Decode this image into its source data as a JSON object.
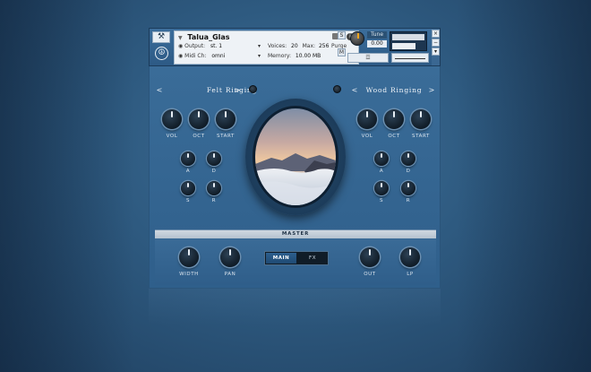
{
  "header": {
    "instrument_name": "Talua_Glas",
    "output_label": "Output:",
    "output_value": "st. 1",
    "midi_label": "Midi Ch:",
    "midi_value": "omni",
    "voices_label": "Voices:",
    "voices_value": "20",
    "max_label": "Max:",
    "max_value": "256",
    "purge_label": "Purge",
    "memory_label": "Memory:",
    "memory_value": "10.00 MB",
    "tune_label": "Tune",
    "tune_value": "0.00",
    "solo_label": "S",
    "mute_label": "M",
    "aux_label": "↑",
    "close_label": "×",
    "min_label": "−",
    "aux_num": "aux"
  },
  "left_engine": {
    "preset_name": "Felt Ringing",
    "knob_labels": [
      "VOL",
      "OCT",
      "START"
    ],
    "env_labels": [
      "A",
      "D",
      "S",
      "R"
    ]
  },
  "right_engine": {
    "preset_name": "Wood Ringing",
    "knob_labels": [
      "VOL",
      "OCT",
      "START"
    ],
    "env_labels": [
      "A",
      "D",
      "S",
      "R"
    ]
  },
  "nav": {
    "prev": "<",
    "next": ">"
  },
  "master": {
    "title": "MASTER",
    "knob_labels": [
      "WIDTH",
      "PAN",
      "OUT",
      "LP"
    ],
    "tabs": [
      "MAIN",
      "FX"
    ],
    "active_tab": "MAIN"
  },
  "colors": {
    "panel": "#3a6c98",
    "accent_orange": "#f2a51c",
    "label": "#d9e3ec"
  }
}
